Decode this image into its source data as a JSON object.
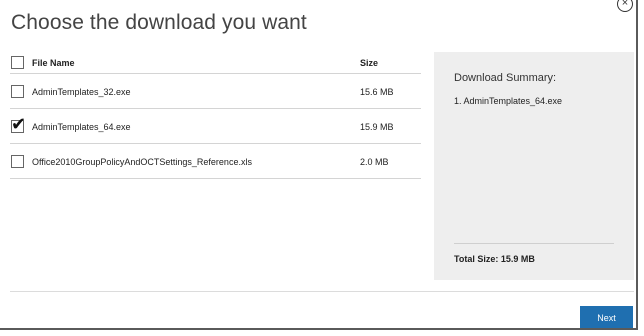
{
  "dialog": {
    "title": "Choose the download you want",
    "close_glyph": "×"
  },
  "table": {
    "headers": {
      "file_name": "File Name",
      "size": "Size"
    },
    "rows": [
      {
        "name": "AdminTemplates_32.exe",
        "size": "15.6 MB",
        "checked": false
      },
      {
        "name": "AdminTemplates_64.exe",
        "size": "15.9 MB",
        "checked": true
      },
      {
        "name": "Office2010GroupPolicyAndOCTSettings_Reference.xls",
        "size": "2.0 MB",
        "checked": false
      }
    ]
  },
  "summary": {
    "title": "Download Summary:",
    "items": [
      "1. AdminTemplates_64.exe"
    ],
    "total": "Total Size: 15.9 MB"
  },
  "footer": {
    "next_label": "Next"
  },
  "icons": {
    "close": "close-icon",
    "check": "checkmark-icon"
  },
  "colors": {
    "accent": "#1f6fb0",
    "summary_bg": "#eeeeee"
  }
}
